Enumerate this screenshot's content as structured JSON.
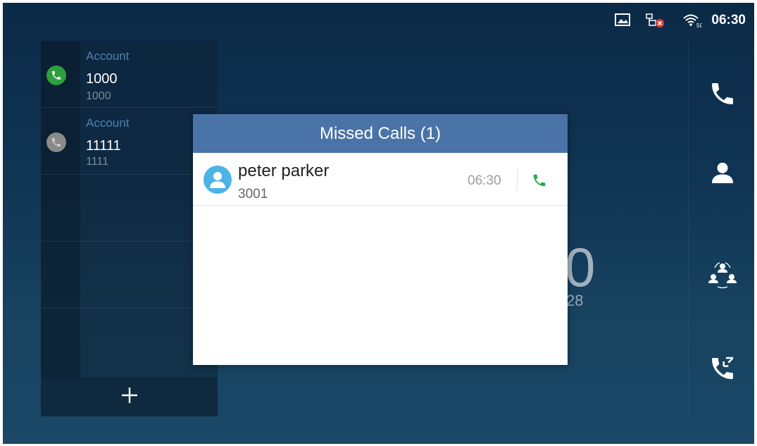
{
  "status_bar": {
    "time": "06:30",
    "icons": [
      "screenshot-icon",
      "network-disconnected-icon",
      "wifi-5g-icon"
    ]
  },
  "accounts": [
    {
      "label": "Account",
      "number": "1000",
      "sub": "1000",
      "status_color": "#2e9e3e"
    },
    {
      "label": "Account",
      "number": "11111",
      "sub": "1111",
      "status_color": "#8a8a8a"
    }
  ],
  "accounts_add_icon": "plus-icon",
  "right_bar_icons": [
    "phone-icon",
    "contact-icon",
    "conference-icon",
    "call-transfer-icon"
  ],
  "background": {
    "clock_digit": "0",
    "date_fragment": "28"
  },
  "missed_calls": {
    "title": "Missed Calls (1)",
    "calls": [
      {
        "name": "peter parker",
        "number": "3001",
        "time": "06:30"
      }
    ]
  },
  "colors": {
    "dialog_header": "#4a74a8",
    "avatar": "#4cb3e6",
    "callback_green": "#2aa84a",
    "account_label": "#4a83b3"
  }
}
